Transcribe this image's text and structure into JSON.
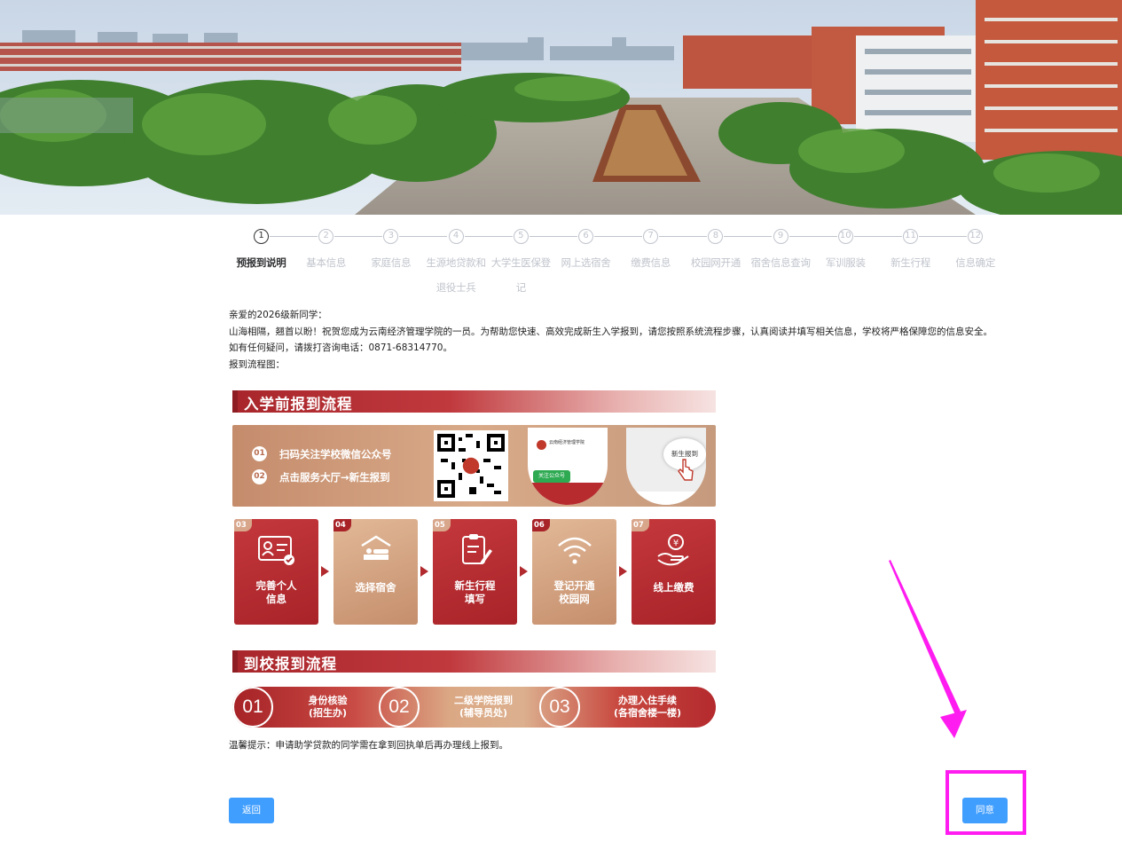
{
  "steps": [
    {
      "num": "1",
      "label": "预报到说明",
      "active": true
    },
    {
      "num": "2",
      "label": "基本信息"
    },
    {
      "num": "3",
      "label": "家庭信息"
    },
    {
      "num": "4",
      "label": "生源地贷款和退役士兵"
    },
    {
      "num": "5",
      "label": "大学生医保登记"
    },
    {
      "num": "6",
      "label": "网上选宿舍"
    },
    {
      "num": "7",
      "label": "缴费信息"
    },
    {
      "num": "8",
      "label": "校园网开通"
    },
    {
      "num": "9",
      "label": "宿舍信息查询"
    },
    {
      "num": "10",
      "label": "军训服装"
    },
    {
      "num": "11",
      "label": "新生行程"
    },
    {
      "num": "12",
      "label": "信息确定"
    }
  ],
  "intro": {
    "greeting": "亲爱的2026级新同学：",
    "welcome": "山海相隔，翘首以盼！祝贺您成为云南经济管理学院的一员。为帮助您快速、高效完成新生入学报到，请您按照系统流程步骤，认真阅读并填写相关信息，学校将严格保障您的信息安全。",
    "contact": "如有任何疑问，请拨打咨询电话：0871-68314770。",
    "flow_label": "报到流程图："
  },
  "flowchart": {
    "pre_title": "入学前报到流程",
    "qr_step1_num": "01",
    "qr_step1": "扫码关注学校微信公众号",
    "qr_step2_num": "02",
    "qr_step2": "点击服务大厅→新生报到",
    "phone1_title": "云南经济管理学院",
    "phone1_follow": "关注公众号",
    "phone2_btn": "新生报到",
    "cards": [
      {
        "tag": "03",
        "line1": "完善个人",
        "line2": "信息",
        "icon": "id-card-icon"
      },
      {
        "tag": "04",
        "line1": "选择宿舍",
        "line2": "",
        "icon": "dorm-bed-icon"
      },
      {
        "tag": "05",
        "line1": "新生行程",
        "line2": "填写",
        "icon": "clipboard-pen-icon"
      },
      {
        "tag": "06",
        "line1": "登记开通",
        "line2": "校园网",
        "icon": "wifi-icon"
      },
      {
        "tag": "07",
        "line1": "线上缴费",
        "line2": "",
        "icon": "yen-hand-icon"
      }
    ],
    "onsite_title": "到校报到流程",
    "onsite": [
      {
        "num": "01",
        "line1": "身份核验",
        "line2": "(招生办)"
      },
      {
        "num": "02",
        "line1": "二级学院报到",
        "line2": "(辅导员处)"
      },
      {
        "num": "03",
        "line1": "办理入住手续",
        "line2": "(各宿舍楼一楼)"
      }
    ]
  },
  "tip": "温馨提示：申请助学贷款的同学需在拿到回执单后再办理线上报到。",
  "buttons": {
    "back": "返回",
    "agree": "同意"
  },
  "colors": {
    "primary": "#409eff",
    "accent_red": "#a82328",
    "tan": "#d8aa89",
    "highlight": "#ff1cf0"
  }
}
